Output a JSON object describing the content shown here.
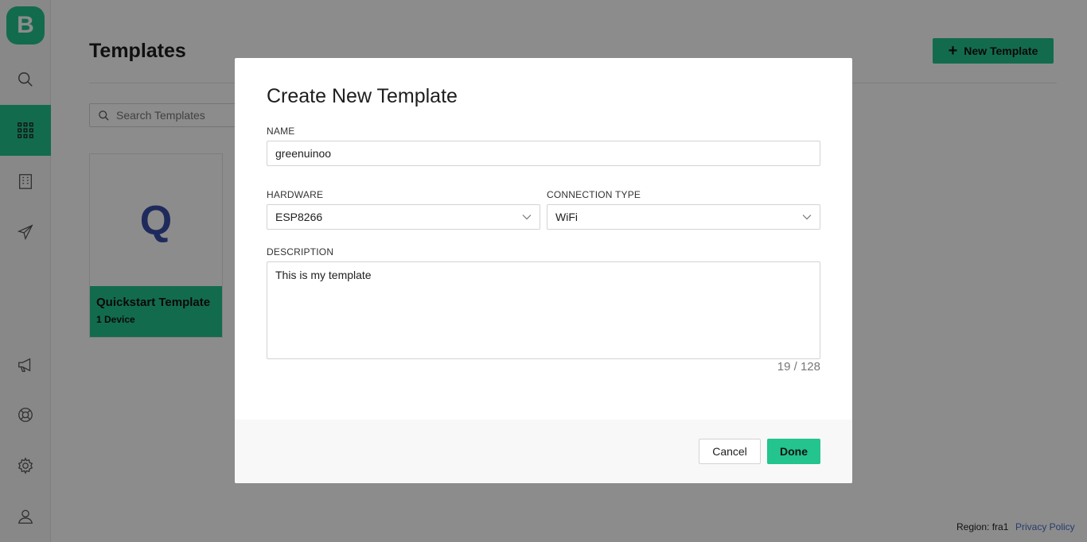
{
  "app": {
    "logo_letter": "B"
  },
  "sidebar": {
    "items": [
      {
        "name": "search",
        "icon": "search-icon"
      },
      {
        "name": "templates",
        "icon": "grid-icon",
        "active": true
      },
      {
        "name": "organizations",
        "icon": "building-icon"
      },
      {
        "name": "send",
        "icon": "paper-plane-icon"
      },
      {
        "name": "announcements",
        "icon": "megaphone-icon"
      },
      {
        "name": "help",
        "icon": "lifebuoy-icon"
      },
      {
        "name": "settings",
        "icon": "gear-icon"
      },
      {
        "name": "profile",
        "icon": "user-icon"
      }
    ]
  },
  "header": {
    "title": "Templates",
    "new_button_label": "New Template"
  },
  "search": {
    "placeholder": "Search Templates"
  },
  "templates": [
    {
      "initial": "Q",
      "name": "Quickstart Template",
      "count": "1 Device"
    }
  ],
  "footer": {
    "region": "Region: fra1",
    "privacy": "Privacy Policy"
  },
  "modal": {
    "title": "Create New Template",
    "name_label": "NAME",
    "name_value": "greenuinoo",
    "hardware_label": "HARDWARE",
    "hardware_value": "ESP8266",
    "connection_label": "CONNECTION TYPE",
    "connection_value": "WiFi",
    "description_label": "DESCRIPTION",
    "description_value": "This is my template",
    "char_count": "19 / 128",
    "cancel_label": "Cancel",
    "done_label": "Done"
  },
  "colors": {
    "accent": "#23c48e",
    "link": "#4a6ec8",
    "card_initial": "#3a4ea8"
  }
}
